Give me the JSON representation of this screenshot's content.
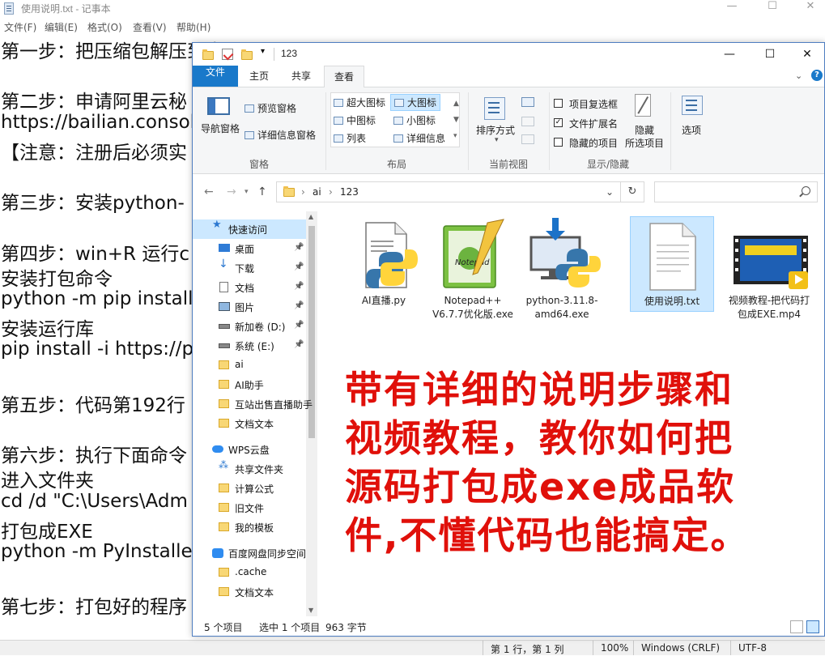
{
  "notepad": {
    "title": "使用说明.txt - 记事本",
    "menu": [
      "文件(F)",
      "编辑(E)",
      "格式(O)",
      "查看(V)",
      "帮助(H)"
    ],
    "lines": [
      "第一步：把压缩包解压到桌面",
      "",
      "第二步：申请阿里云秘",
      "https://bailian.consol",
      "【注意：注册后必须实",
      "",
      "第三步：安装python-",
      "",
      "第四步：win+R 运行c",
      "安装打包命令",
      "python -m pip install",
      "安装运行库",
      "pip install -i https://p",
      "",
      "第五步：代码第192行",
      "",
      "第六步：执行下面命令",
      "进入文件夹",
      "cd /d \"C:\\Users\\Adm",
      "打包成EXE",
      "python -m PyInstalle",
      "",
      "第七步：打包好的程序"
    ],
    "status": {
      "position": "第 1 行，第 1 列",
      "zoom": "100%",
      "line_ending": "Windows (CRLF)",
      "encoding": "UTF-8"
    }
  },
  "explorer": {
    "title": "123",
    "tabs": [
      "文件",
      "主页",
      "共享",
      "查看"
    ],
    "active_tab": "查看",
    "ribbon": {
      "pane": {
        "nav_pane": "导航窗格",
        "preview": "预览窗格",
        "details": "详细信息窗格",
        "group": "窗格"
      },
      "layout": {
        "items": [
          "超大图标",
          "大图标",
          "中图标",
          "小图标",
          "列表",
          "详细信息"
        ],
        "selected": "大图标",
        "group": "布局"
      },
      "current_view": {
        "sort_by": "排序方式",
        "group": "当前视图"
      },
      "show_hide": {
        "item_checkboxes": "项目复选框",
        "file_extensions": "文件扩展名",
        "hidden_items": "隐藏的项目",
        "hide_selected_line1": "隐藏",
        "hide_selected_line2": "所选项目",
        "group": "显示/隐藏"
      },
      "options": "选项"
    },
    "breadcrumb": [
      "ai",
      "123"
    ],
    "nav": [
      {
        "label": "快速访问",
        "icon": "star-icon"
      },
      {
        "label": "桌面",
        "icon": "desktop-icon",
        "pinned": true
      },
      {
        "label": "下载",
        "icon": "download-icon",
        "pinned": true
      },
      {
        "label": "文档",
        "icon": "document-icon",
        "pinned": true
      },
      {
        "label": "图片",
        "icon": "picture-icon",
        "pinned": true
      },
      {
        "label": "新加卷 (D:)",
        "icon": "drive-icon",
        "pinned": true
      },
      {
        "label": "系统 (E:)",
        "icon": "drive-icon",
        "pinned": true
      },
      {
        "label": "ai",
        "icon": "folder-icon"
      },
      {
        "label": "AI助手",
        "icon": "folder-icon"
      },
      {
        "label": "互站出售直播助手",
        "icon": "folder-icon"
      },
      {
        "label": "文档文本",
        "icon": "folder-icon"
      },
      {
        "label": "WPS云盘",
        "icon": "cloud-icon"
      },
      {
        "label": "共享文件夹",
        "icon": "share-icon"
      },
      {
        "label": "计算公式",
        "icon": "folder-icon"
      },
      {
        "label": "旧文件",
        "icon": "folder-icon"
      },
      {
        "label": "我的模板",
        "icon": "folder-icon"
      },
      {
        "label": "百度网盘同步空间",
        "icon": "baidu-cloud-icon"
      },
      {
        "label": ".cache",
        "icon": "folder-icon"
      },
      {
        "label": "文档文本",
        "icon": "folder-icon"
      }
    ],
    "files": [
      {
        "name": "AI直播.py",
        "icon": "python-file-icon"
      },
      {
        "name": "Notepad++ V6.7.7优化版.exe",
        "icon": "notepad-plus-plus-icon"
      },
      {
        "name": "python-3.11.8-amd64.exe",
        "icon": "python-installer-icon"
      },
      {
        "name": "使用说明.txt",
        "icon": "text-file-icon",
        "selected": true
      },
      {
        "name": "视频教程-把代码打包成EXE.mp4",
        "icon": "video-file-icon"
      }
    ],
    "overlay_text": [
      "带有详细的说明步骤和",
      "视频教程，教你如何把",
      "源码打包成exe成品软",
      "件,不懂代码也能搞定。"
    ],
    "status": {
      "count": "5 个项目",
      "selection": "选中 1 个项目",
      "size": "963 字节"
    }
  },
  "colors": {
    "accent": "#1979ca",
    "overlay": "#e0100a",
    "selection": "#cce8ff"
  }
}
